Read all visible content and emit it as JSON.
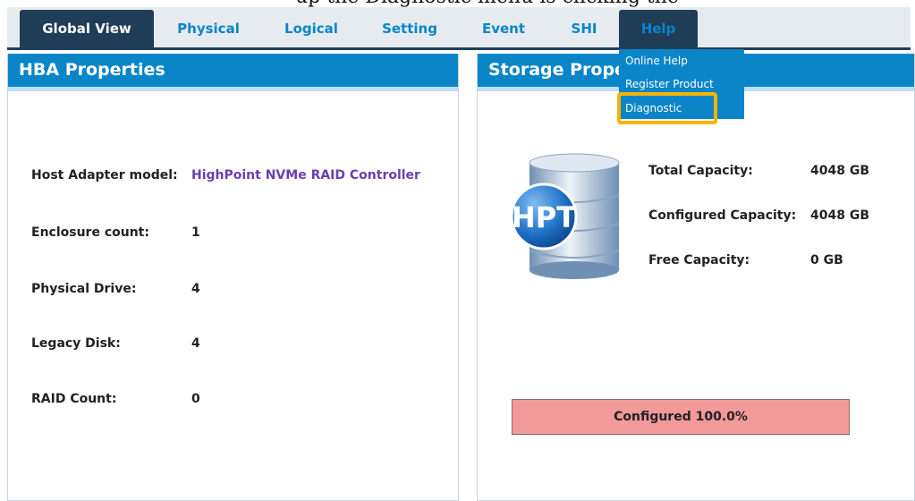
{
  "top_caption_partial": "up the Diagnostic menu is clicking the",
  "tabs": [
    {
      "label": "Global View",
      "state": "active"
    },
    {
      "label": "Physical",
      "state": "normal"
    },
    {
      "label": "Logical",
      "state": "normal"
    },
    {
      "label": "Setting",
      "state": "normal"
    },
    {
      "label": "Event",
      "state": "normal"
    },
    {
      "label": "SHI",
      "state": "normal"
    },
    {
      "label": "Help",
      "state": "open"
    }
  ],
  "help_menu": {
    "items": [
      "Online Help",
      "Register Product",
      "Diagnostic"
    ],
    "highlighted": "Diagnostic"
  },
  "hba_panel": {
    "title": "HBA Properties",
    "rows": [
      {
        "label": "Host Adapter model:",
        "value": "HighPoint NVMe RAID Controller"
      },
      {
        "label": "Enclosure count:",
        "value": "1"
      },
      {
        "label": "Physical Drive:",
        "value": "4"
      },
      {
        "label": "Legacy Disk:",
        "value": "4"
      },
      {
        "label": "RAID Count:",
        "value": "0"
      }
    ]
  },
  "storage_panel": {
    "title": "Storage Properties",
    "logo_text": "HPT",
    "capacity": [
      {
        "label": "Total Capacity:",
        "value": "4048 GB"
      },
      {
        "label": "Configured Capacity:",
        "value": "4048 GB"
      },
      {
        "label": "Free Capacity:",
        "value": "0 GB"
      }
    ],
    "configured_label": "Configured 100.0%",
    "configured_fraction": 1.0
  },
  "colors": {
    "tab_active_bg": "#1f3d57",
    "tab_text": "#0a85c8",
    "panel_header_bg": "#0a85c8",
    "model_value": "#6a3fb0",
    "configured_bar": "#f2999a",
    "highlight_box": "#f5b400"
  },
  "icons": [
    "hpt-database-icon"
  ]
}
